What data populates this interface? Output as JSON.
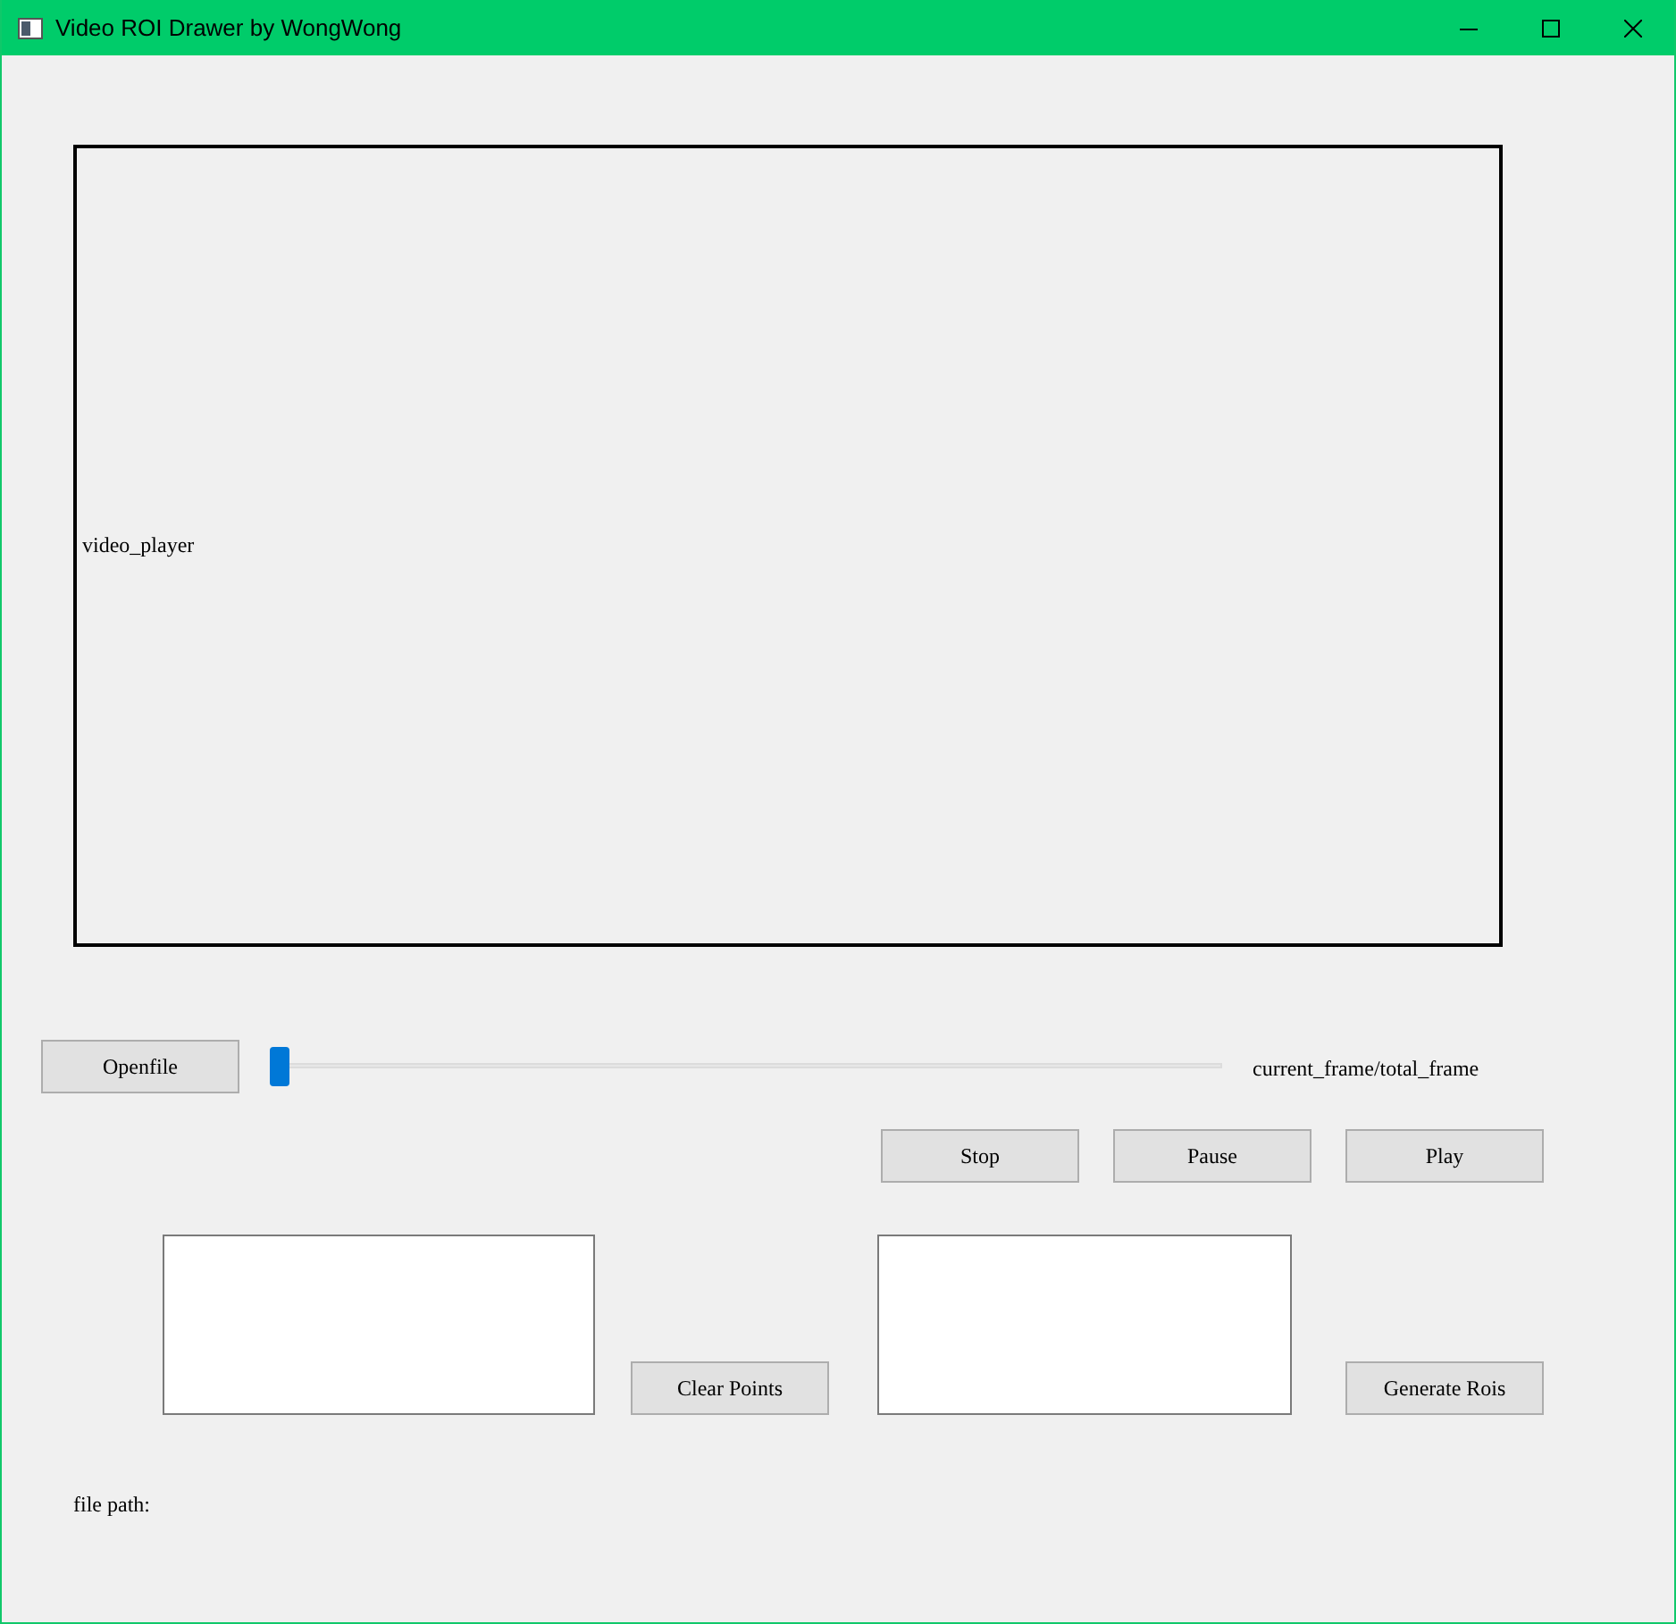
{
  "window": {
    "title": "Video ROI Drawer by WongWong"
  },
  "video": {
    "label": "video_player"
  },
  "open_button": "Openfile",
  "slider": {
    "level": 0
  },
  "frame_label": "current_frame/total_frame",
  "playback_buttons": [
    "Stop",
    "Pause",
    "Play"
  ],
  "clear_button": "Clear Points",
  "generate_button": "Generate Rois",
  "file_path_label": "file path:"
}
